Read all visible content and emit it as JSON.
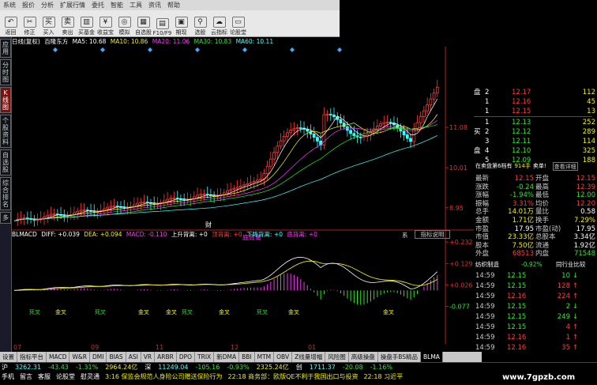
{
  "menu": [
    "系统",
    "报价",
    "分析",
    "扩展行情",
    "委托",
    "智能",
    "工具",
    "资讯",
    "帮助"
  ],
  "toolbar": [
    {
      "icon": "↶",
      "label": "返回"
    },
    {
      "icon": "✂",
      "label": "修正"
    },
    {
      "icon": "买",
      "label": "买入"
    },
    {
      "icon": "卖",
      "label": "卖出"
    },
    {
      "icon": "▥",
      "label": "买基金"
    },
    {
      "icon": "¥",
      "label": "收益宝"
    },
    {
      "icon": "◎",
      "label": "模拟"
    },
    {
      "icon": "▦",
      "label": "自选股"
    },
    {
      "icon": "▤",
      "label": "F10/F9"
    },
    {
      "icon": "▣",
      "label": "期现"
    },
    {
      "icon": "⚲",
      "label": "选股"
    },
    {
      "icon": "☁",
      "label": "云指标"
    },
    {
      "icon": "▭",
      "label": "论股堂"
    }
  ],
  "sidetabs": [
    {
      "label": "应用",
      "active": false
    },
    {
      "label": "分时图",
      "active": false
    },
    {
      "label": "K线图",
      "active": true
    },
    {
      "label": "个股资料",
      "active": false
    },
    {
      "label": "自选股",
      "active": false
    },
    {
      "label": "综合排名",
      "active": false
    },
    {
      "label": "多",
      "active": false
    }
  ],
  "chart_head": {
    "period": "日线(复权)",
    "name": "百隆东方",
    "ma5": "MA5: 10.68",
    "ma10": "MA10: 10.86",
    "ma20": "MA20: 11.06",
    "ma30": "MA30: 10.83",
    "ma60": "MA60: 10.11"
  },
  "price_axis": [
    "11.08",
    "10.01",
    "8.95"
  ],
  "macd_axis": [
    "+0.232",
    "+0.129",
    "+0.026",
    "-0.077"
  ],
  "macd_head": {
    "title": "BLMACD",
    "diff": "DIFF: +0.039",
    "dea": "DEA: +0.094",
    "macd": "MACD: -0.110",
    "up": "上升背离: +0",
    "top": "顶背离: +0",
    "down": "下降背离: +0",
    "bottom": "底背离: +0"
  },
  "explain_label": "指标说明",
  "macd_tag": "系",
  "rights_tag": "财",
  "bottom_label": "底背离",
  "macd_labels": [
    "死叉",
    "金叉",
    "死叉",
    "金叉",
    "金叉",
    "死叉",
    "金叉",
    "死叉",
    "金叉",
    "金叉"
  ],
  "x_axis": [
    "07",
    "09",
    "11",
    "12",
    "01"
  ],
  "tabs": [
    "设置",
    "指标平台",
    "MACD",
    "W&R",
    "DMI",
    "BIAS",
    "ASI",
    "VR",
    "ARBR",
    "DPO",
    "TRIX",
    "新DMA",
    "BBI",
    "MTM",
    "OBV",
    "Z线量增幅",
    "风险图",
    "高级操盘",
    "操盘手BS精品",
    "BLMA"
  ],
  "quote": {
    "sell": [
      {
        "lbl": "盘",
        "n": "2",
        "p": "12.17",
        "v": "112"
      },
      {
        "lbl": "",
        "n": "1",
        "p": "12.16",
        "v": "45"
      },
      {
        "lbl": "",
        "n": "1",
        "p": "12.15",
        "v": "13"
      }
    ],
    "buy": [
      {
        "lbl": "",
        "n": "1",
        "p": "12.13",
        "v": "252"
      },
      {
        "lbl": "买",
        "n": "2",
        "p": "12.12",
        "v": "289"
      },
      {
        "lbl": "",
        "n": "3",
        "p": "12.11",
        "v": "114"
      },
      {
        "lbl": "盘",
        "n": "4",
        "p": "12.10",
        "v": "325"
      },
      {
        "lbl": "",
        "n": "5",
        "p": "12.09",
        "v": "188"
      }
    ],
    "infoline": {
      "a": "在卖盘第6档有",
      "b": "914手",
      "c": "卖单!",
      "d": "查看详细"
    },
    "rows": [
      {
        "l": "最新",
        "lv": "12.15",
        "r": "开盘",
        "rv": "12.15"
      },
      {
        "l": "涨跌",
        "lv": "-0.24",
        "r": "最高",
        "rv": "12.39"
      },
      {
        "l": "涨幅",
        "lv": "-1.94%",
        "r": "最低",
        "rv": "12.00"
      },
      {
        "l": "振幅",
        "lv": "3.31%",
        "r": "均价",
        "rv": "12.20"
      },
      {
        "l": "总手",
        "lv": "14.01万",
        "r": "量比",
        "rv": "0.58"
      },
      {
        "l": "金额",
        "lv": "1.71亿",
        "r": "换手",
        "rv": "7.29%"
      },
      {
        "l": "市盈",
        "lv": "17.95",
        "r": "市盈(动)",
        "rv": "17.95"
      },
      {
        "l": "市值",
        "lv": "23.33亿",
        "r": "总股本",
        "rv": "3.34亿"
      },
      {
        "l": "股本",
        "lv": "7.50亿",
        "r": "流通",
        "rv": "1.92亿"
      },
      {
        "l": "外盘",
        "lv": "68513",
        "r": "内盘",
        "rv": "71548"
      }
    ],
    "perf": {
      "a": "纺织制造",
      "b": "-0.92%",
      "c": "同行业比较"
    },
    "ticks": [
      {
        "t": "14:59",
        "p": "12.15",
        "v": "10",
        "d": "↓"
      },
      {
        "t": "14:59",
        "p": "12.15",
        "v": "128",
        "d": "↑"
      },
      {
        "t": "14:59",
        "p": "12.16",
        "v": "224",
        "d": "↑"
      },
      {
        "t": "14:59",
        "p": "12.15",
        "v": "2",
        "d": "↓"
      },
      {
        "t": "14:59",
        "p": "12.15",
        "v": "249",
        "d": "↓"
      },
      {
        "t": "14:59",
        "p": "12.15",
        "v": "4",
        "d": "↑"
      },
      {
        "t": "14:59",
        "p": "12.16",
        "v": "1",
        "d": "↑"
      },
      {
        "t": "14:59",
        "p": "12.16",
        "v": "35",
        "d": "↑"
      }
    ]
  },
  "status": {
    "line1": [
      {
        "t": "沪",
        "c": "wht"
      },
      {
        "t": "3262.31",
        "c": "cyn"
      },
      {
        "t": "-43.43",
        "c": "grn"
      },
      {
        "t": "-1.31%",
        "c": "grn"
      },
      {
        "t": "2964.24亿",
        "c": "yel"
      },
      {
        "t": "深",
        "c": "wht"
      },
      {
        "t": "11249.04",
        "c": "cyn"
      },
      {
        "t": "-105.16",
        "c": "grn"
      },
      {
        "t": "-0.93%",
        "c": "grn"
      },
      {
        "t": "2325.24亿",
        "c": "yel"
      },
      {
        "t": "创",
        "c": "wht"
      },
      {
        "t": "1711.37",
        "c": "cyn"
      },
      {
        "t": "-20.08",
        "c": "grn"
      },
      {
        "t": "-1.16%",
        "c": "grn"
      }
    ],
    "line2": [
      {
        "t": "手机",
        "c": "wht"
      },
      {
        "t": "留言",
        "c": "wht"
      },
      {
        "t": "客服",
        "c": "wht"
      },
      {
        "t": "论股堂",
        "c": "wht"
      },
      {
        "t": "慰灵通",
        "c": "wht"
      },
      {
        "t": "3:16 保监会规范人身险公司赠送保险行为",
        "c": "yel"
      },
      {
        "t": "22:18 商务部：欧版QE不利于我国出口与投资",
        "c": "yel"
      },
      {
        "t": "22:18 习近平",
        "c": "yel"
      }
    ],
    "watermark": "www.7gpzb.com"
  }
}
